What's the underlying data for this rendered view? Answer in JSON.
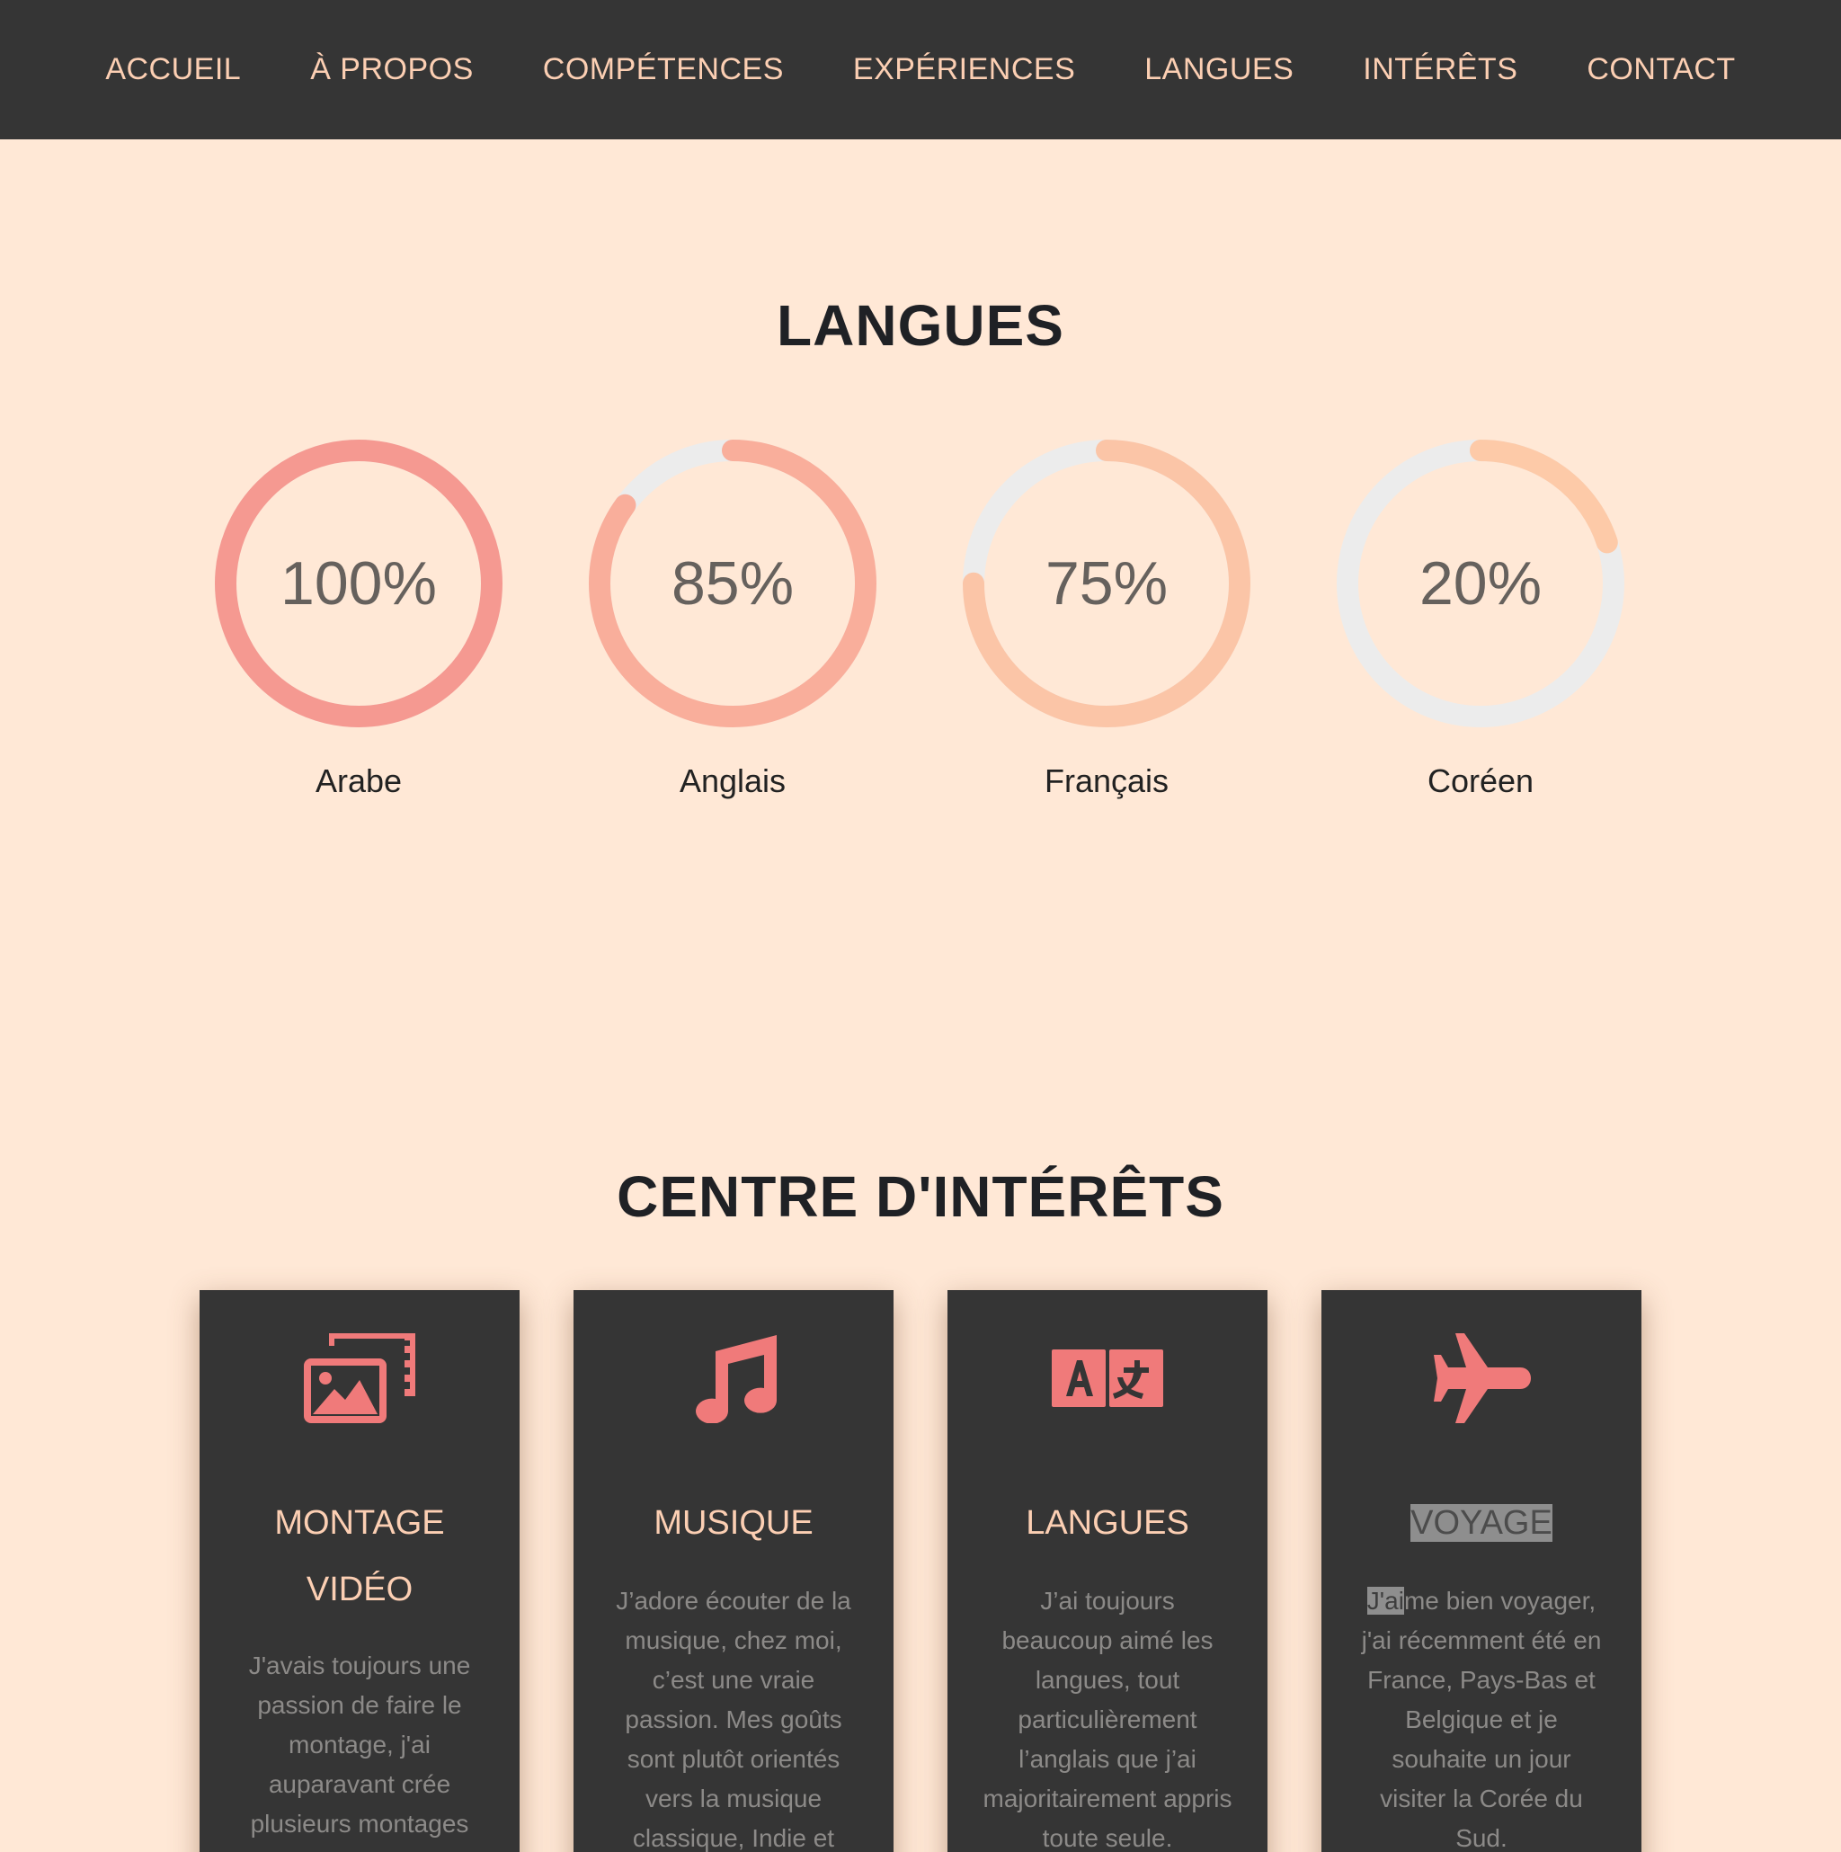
{
  "nav": {
    "items": [
      "ACCUEIL",
      "À PROPOS",
      "COMPÉTENCES",
      "EXPÉRIENCES",
      "LANGUES",
      "INTÉRÊTS",
      "CONTACT"
    ]
  },
  "langues": {
    "title": "LANGUES",
    "items": [
      {
        "name": "Arabe",
        "percent_label": "100%",
        "value": 100,
        "color": "#f59991"
      },
      {
        "name": "Anglais",
        "percent_label": "85%",
        "value": 85,
        "color": "#f9ae9b"
      },
      {
        "name": "Français",
        "percent_label": "75%",
        "value": 75,
        "color": "#fbc5a7"
      },
      {
        "name": "Coréen",
        "percent_label": "20%",
        "value": 20,
        "color": "#fdcaa8"
      }
    ],
    "track_color": "#ececec"
  },
  "interets": {
    "title": "CENTRE D'INTÉRÊTS",
    "accent_color": "#f07a7a",
    "cards": [
      {
        "icon": "photo-film-icon",
        "title": "MONTAGE VIDÉO",
        "text": "J'avais toujours une passion de faire le montage, j'ai auparavant crée plusieurs montages"
      },
      {
        "icon": "music-note-icon",
        "title": "MUSIQUE",
        "text": "J’adore écouter de la musique, chez moi, c’est une vraie passion. Mes goûts sont plutôt orientés vers la musique classique, Indie et"
      },
      {
        "icon": "language-icon",
        "title": "LANGUES",
        "text": "J’ai toujours beaucoup aimé les langues, tout particulièrement l’anglais que j’ai majoritairement appris toute seule."
      },
      {
        "icon": "plane-icon",
        "title": "VOYAGE",
        "text_highlight": "J'ai",
        "text_rest": "me bien voyager, j'ai récemment été en France, Pays-Bas et Belgique et je souhaite un jour visiter la Corée du Sud."
      }
    ]
  }
}
